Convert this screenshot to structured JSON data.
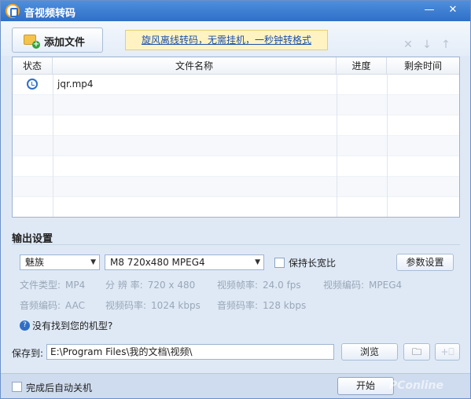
{
  "window": {
    "title": "音视频转码",
    "minimize": "—",
    "close": "✕"
  },
  "toolbar": {
    "add_files": "添加文件",
    "promo_link": "旋风离线转码，无需挂机，一秒钟转格式",
    "icons": [
      "delete-icon",
      "move-down-icon",
      "move-up-icon"
    ]
  },
  "table": {
    "headers": {
      "status": "状态",
      "filename": "文件名称",
      "progress": "进度",
      "remaining": "剩余时间"
    },
    "rows": [
      {
        "filename": "jqr.mp4",
        "status_icon": "clock-icon",
        "progress": "",
        "remaining": ""
      }
    ]
  },
  "output": {
    "title": "输出设置",
    "device_select": "魅族",
    "format_select": "M8 720x480 MPEG4",
    "keep_ratio_label": "保持长宽比",
    "params_button": "参数设置",
    "file_type_label": "文件类型:",
    "file_type_value": "MP4",
    "resolution_label": "分 辨 率:",
    "resolution_value": "720 x 480",
    "frame_rate_label": "视频帧率:",
    "frame_rate_value": "24.0 fps",
    "video_codec_label": "视频编码:",
    "video_codec_value": "MPEG4",
    "audio_codec_label": "音频编码:",
    "audio_codec_value": "AAC",
    "video_bitrate_label": "视频码率:",
    "video_bitrate_value": "1024 kbps",
    "audio_bitrate_label": "音频码率:",
    "audio_bitrate_value": "128 kbps",
    "help_text": "没有找到您的机型?"
  },
  "save": {
    "label": "保存到:",
    "path": "E:\\Program Files\\我的文档\\视频\\",
    "browse_button": "浏览"
  },
  "footer": {
    "shutdown_label": "完成后自动关机",
    "start_button": "开始",
    "watermark": "PConline"
  },
  "colors": {
    "title_bar": "#2f6fc8",
    "background": "#dfe9f6",
    "promo_bg": "#fff3c2"
  }
}
